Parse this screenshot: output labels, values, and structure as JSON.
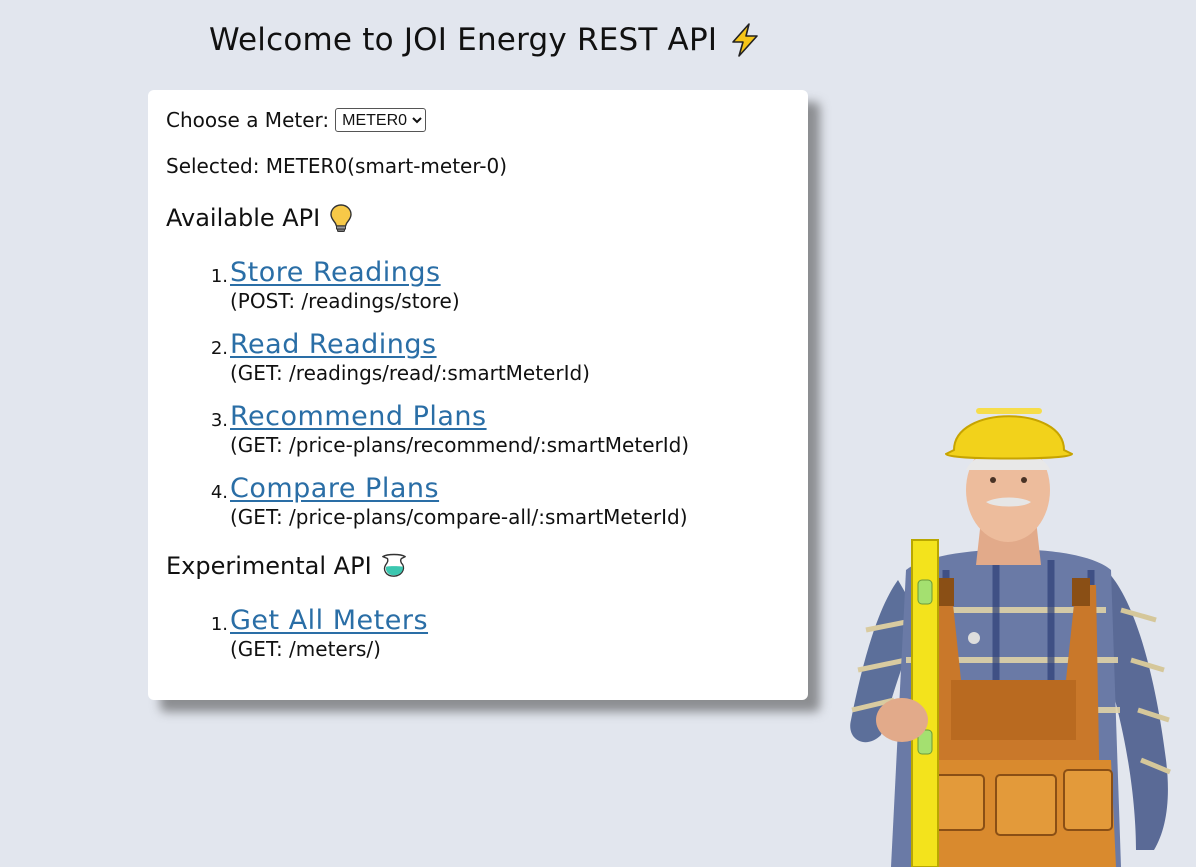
{
  "header": {
    "title": "Welcome to JOI Energy REST API",
    "title_icon": "lightning-bolt-icon"
  },
  "meter": {
    "label": "Choose a Meter:",
    "selected_option": "METER0",
    "selected_label": "Selected:",
    "selected_value": "METER0(smart-meter-0)"
  },
  "available": {
    "heading": "Available API",
    "heading_icon": "lightbulb-icon",
    "items": [
      {
        "num": "1.",
        "label": "Store Readings",
        "desc": "(POST: /readings/store)"
      },
      {
        "num": "2.",
        "label": "Read Readings",
        "desc": "(GET: /readings/read/:smartMeterId)"
      },
      {
        "num": "3.",
        "label": "Recommend Plans",
        "desc": "(GET: /price-plans/recommend/:smartMeterId)"
      },
      {
        "num": "4.",
        "label": "Compare Plans",
        "desc": "(GET: /price-plans/compare-all/:smartMeterId)"
      }
    ]
  },
  "experimental": {
    "heading": "Experimental API",
    "heading_icon": "flask-icon",
    "items": [
      {
        "num": "1.",
        "label": "Get All Meters",
        "desc": "(GET: /meters/)"
      }
    ]
  },
  "colors": {
    "background": "#e2e6ee",
    "card": "#ffffff",
    "link": "#2a6ea6",
    "bolt": "#f5c518"
  },
  "illustration": "construction-worker-image"
}
